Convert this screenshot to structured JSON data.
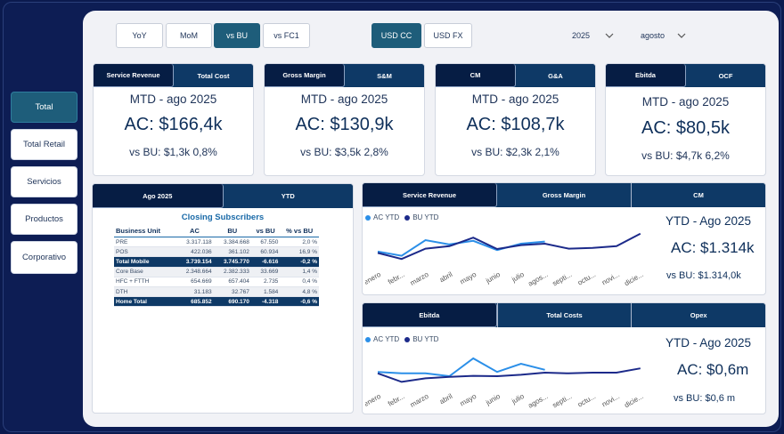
{
  "nav": [
    "Total",
    "Total Retail",
    "Servicios",
    "Productos",
    "Corporativo"
  ],
  "toggles": [
    "YoY",
    "MoM",
    "vs BU",
    "vs FC1"
  ],
  "currency": [
    "USD CC",
    "USD FX"
  ],
  "filters": {
    "year": "2025",
    "month": "agosto"
  },
  "kpis": [
    {
      "tabs": [
        "Service Revenue",
        "Total Cost"
      ],
      "period": "MTD - ago 2025",
      "ac": "AC: $166,4k",
      "vs": "vs BU: $1,3k  0,8%"
    },
    {
      "tabs": [
        "Gross Margin",
        "S&M"
      ],
      "period": "MTD - ago 2025",
      "ac": "AC: $130,9k",
      "vs": "vs BU: $3,5k  2,8%"
    },
    {
      "tabs": [
        "CM",
        "G&A"
      ],
      "period": "MTD - ago 2025",
      "ac": "AC: $108,7k",
      "vs": "vs BU: $2,3k  2,1%"
    },
    {
      "tabs": [
        "Ebitda",
        "OCF"
      ],
      "period": "MTD - ago 2025",
      "ac": "AC: $80,5k",
      "vs": "vs BU: $4,7k  6,2%"
    }
  ],
  "subs": {
    "tabs": [
      "Ago 2025",
      "YTD"
    ],
    "title": "Closing Subscribers",
    "headers": [
      "Business Unit",
      "AC",
      "BU",
      "vs BU",
      "% vs BU"
    ],
    "rows": [
      [
        "PRE",
        "3.317.118",
        "3.384.668",
        "67.550",
        "2,0 %"
      ],
      [
        "POS",
        "422.036",
        "361.102",
        "60.934",
        "16,9 %"
      ],
      [
        "Total Mobile",
        "3.739.154",
        "3.745.770",
        "-6.616",
        "-0,2 %"
      ],
      [
        "Core Base",
        "2.348.664",
        "2.382.333",
        "33.669",
        "1,4 %"
      ],
      [
        "HFC + FTTH",
        "654.669",
        "657.404",
        "2.735",
        "0,4 %"
      ],
      [
        "DTH",
        "31.183",
        "32.767",
        "1.584",
        "4,8 %"
      ],
      [
        "Home Total",
        "685.852",
        "690.170",
        "-4.318",
        "-0,6 %"
      ]
    ]
  },
  "months": [
    "enero",
    "febr...",
    "marzo",
    "abril",
    "mayo",
    "junio",
    "julio",
    "agos...",
    "septi...",
    "octu...",
    "novi...",
    "dicie..."
  ],
  "colors": {
    "ac": "#2b8fe8",
    "bu": "#1c2a8a"
  },
  "charts": [
    {
      "tabs": [
        "Service Revenue",
        "Gross Margin",
        "CM"
      ],
      "legend": {
        "ac": "AC YTD",
        "bu": "BU YTD"
      },
      "title": "YTD - Ago 2025",
      "ac": "AC: $1.314k",
      "vs": "vs BU: $1.314,0k",
      "chart_data": {
        "type": "line",
        "categories": [
          "enero",
          "febr...",
          "marzo",
          "abril",
          "mayo",
          "junio",
          "julio",
          "agos...",
          "septi...",
          "octu...",
          "novi...",
          "dicie..."
        ],
        "series": [
          {
            "name": "AC YTD",
            "values": [
              0.38,
              0.26,
              0.7,
              0.58,
              0.68,
              0.42,
              0.6,
              0.66,
              null,
              null,
              null,
              null
            ]
          },
          {
            "name": "BU YTD",
            "values": [
              0.34,
              0.17,
              0.46,
              0.53,
              0.77,
              0.45,
              0.56,
              0.6,
              0.46,
              0.48,
              0.53,
              0.88
            ]
          }
        ]
      }
    },
    {
      "tabs": [
        "Ebitda",
        "Total Costs",
        "Opex"
      ],
      "legend": {
        "ac": "AC YTD",
        "bu": "BU YTD"
      },
      "title": "YTD - Ago 2025",
      "ac": "AC: $0,6m",
      "vs": "vs BU: $0,6 m",
      "chart_data": {
        "type": "line",
        "categories": [
          "enero",
          "febr...",
          "marzo",
          "abril",
          "mayo",
          "junio",
          "julio",
          "agos...",
          "septi...",
          "octu...",
          "novi...",
          "dicie..."
        ],
        "series": [
          {
            "name": "AC YTD",
            "values": [
              0.42,
              0.38,
              0.38,
              0.3,
              0.8,
              0.42,
              0.65,
              0.48,
              null,
              null,
              null,
              null
            ]
          },
          {
            "name": "BU YTD",
            "values": [
              0.38,
              0.14,
              0.24,
              0.28,
              0.31,
              0.3,
              0.34,
              0.4,
              0.38,
              0.4,
              0.4,
              0.52
            ]
          }
        ]
      }
    }
  ]
}
